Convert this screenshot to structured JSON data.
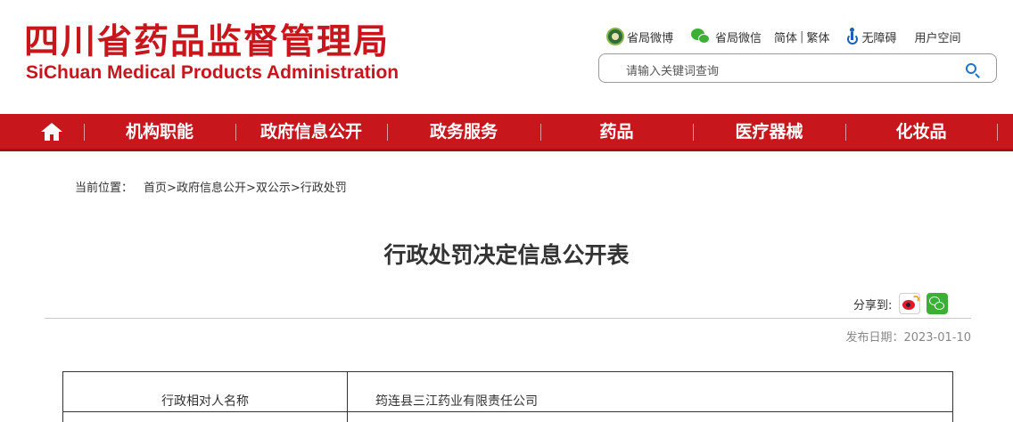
{
  "header": {
    "title_cn": "四川省药品监督管理局",
    "title_en": "SiChuan Medical Products Administration",
    "links": {
      "weibo": "省局微博",
      "wechat": "省局微信",
      "simplified": "简体",
      "separator": "|",
      "traditional": "繁体",
      "accessibility": "无障碍",
      "user_space": "用户空间"
    },
    "search_placeholder": "请输入关键词查询"
  },
  "nav": {
    "items": [
      "机构职能",
      "政府信息公开",
      "政务服务",
      "药品",
      "医疗器械",
      "化妆品"
    ]
  },
  "breadcrumb": {
    "label": "当前位置：",
    "items": [
      "首页",
      "政府信息公开",
      "双公示",
      "行政处罚"
    ],
    "separator": ">"
  },
  "article": {
    "title": "行政处罚决定信息公开表",
    "share_label": "分享到:",
    "publish_date": "发布日期：2023-01-10"
  },
  "table": {
    "rows": [
      {
        "key": "行政相对人名称",
        "value": "筠连县三江药业有限责任公司"
      }
    ]
  },
  "colors": {
    "brand_red": "#c8161d",
    "text": "#333333",
    "muted": "#888888"
  }
}
